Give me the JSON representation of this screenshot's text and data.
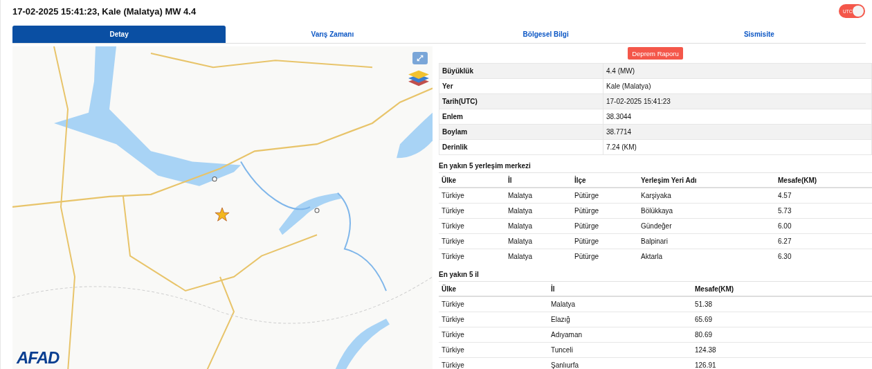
{
  "header": {
    "title": "17-02-2025 15:41:23, Kale (Malatya) MW 4.4",
    "utc_toggle": {
      "label": "UTC",
      "on": true
    }
  },
  "tabs": [
    {
      "label": "Detay",
      "selected": true
    },
    {
      "label": "Varış Zamanı",
      "selected": false
    },
    {
      "label": "Bölgesel Bilgi",
      "selected": false
    },
    {
      "label": "Sismisite",
      "selected": false
    }
  ],
  "map": {
    "logo": "AFAD"
  },
  "report_button": "Deprem Raporu",
  "details": [
    {
      "label": "Büyüklük",
      "value": "4.4 (MW)"
    },
    {
      "label": "Yer",
      "value": "Kale (Malatya)"
    },
    {
      "label": "Tarih(UTC)",
      "value": "17-02-2025 15:41:23"
    },
    {
      "label": "Enlem",
      "value": "38.3044"
    },
    {
      "label": "Boylam",
      "value": "38.7714"
    },
    {
      "label": "Derinlik",
      "value": "7.24 (KM)"
    }
  ],
  "settlements": {
    "title": "En yakın 5 yerleşim merkezi",
    "columns": [
      "Ülke",
      "İl",
      "İlçe",
      "Yerleşim Yeri Adı",
      "Mesafe(KM)"
    ],
    "rows": [
      [
        "Türkiye",
        "Malatya",
        "Pütürge",
        "Karşiyaka",
        "4.57"
      ],
      [
        "Türkiye",
        "Malatya",
        "Pütürge",
        "Bölükkaya",
        "5.73"
      ],
      [
        "Türkiye",
        "Malatya",
        "Pütürge",
        "Gündeğer",
        "6.00"
      ],
      [
        "Türkiye",
        "Malatya",
        "Pütürge",
        "Balpinari",
        "6.27"
      ],
      [
        "Türkiye",
        "Malatya",
        "Pütürge",
        "Aktarla",
        "6.30"
      ]
    ]
  },
  "provinces": {
    "title": "En yakın 5 il",
    "columns": [
      "Ülke",
      "İl",
      "Mesafe(KM)"
    ],
    "rows": [
      [
        "Türkiye",
        "Malatya",
        "51.38"
      ],
      [
        "Türkiye",
        "Elazığ",
        "65.69"
      ],
      [
        "Türkiye",
        "Adıyaman",
        "80.69"
      ],
      [
        "Türkiye",
        "Tunceli",
        "124.38"
      ],
      [
        "Türkiye",
        "Şanlıurfa",
        "126.91"
      ]
    ]
  }
}
